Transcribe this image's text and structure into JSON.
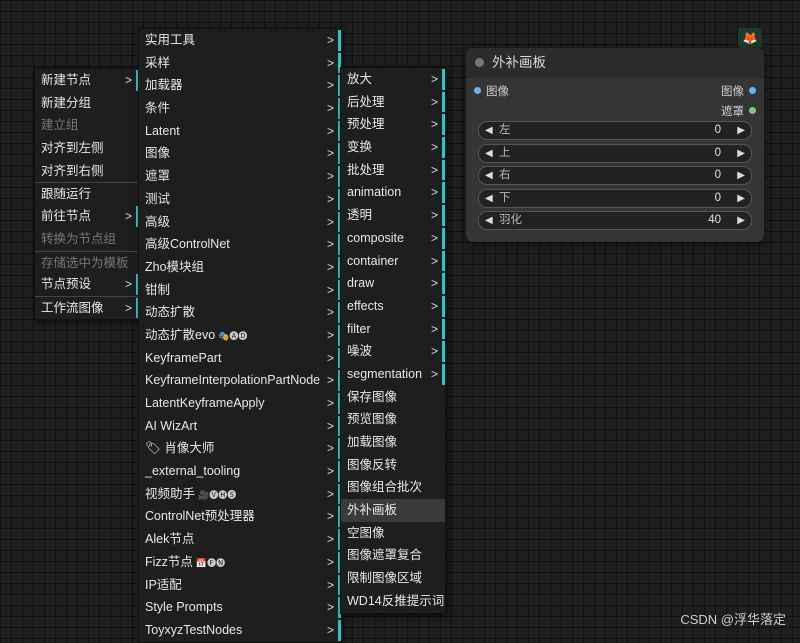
{
  "menu1": {
    "items": [
      {
        "label": "新建节点",
        "arrow": true,
        "bar": true,
        "disabled": false,
        "sep": false,
        "name": "new-node"
      },
      {
        "label": "新建分组",
        "arrow": false,
        "bar": false,
        "disabled": false,
        "sep": false,
        "name": "new-group"
      },
      {
        "label": "建立组",
        "arrow": false,
        "bar": false,
        "disabled": true,
        "sep": false,
        "name": "create-group"
      },
      {
        "label": "对齐到左侧",
        "arrow": false,
        "bar": false,
        "disabled": false,
        "sep": false,
        "name": "align-left"
      },
      {
        "label": "对齐到右侧",
        "arrow": false,
        "bar": false,
        "disabled": false,
        "sep": false,
        "name": "align-right"
      },
      {
        "label": "跟随运行",
        "arrow": false,
        "bar": false,
        "disabled": false,
        "sep": true,
        "name": "follow-run"
      },
      {
        "label": "前往节点",
        "arrow": true,
        "bar": true,
        "disabled": false,
        "sep": false,
        "name": "goto-node"
      },
      {
        "label": "转换为节点组",
        "arrow": false,
        "bar": false,
        "disabled": true,
        "sep": false,
        "name": "convert-to-group-node"
      },
      {
        "label": "存储选中为模板",
        "arrow": false,
        "bar": false,
        "disabled": true,
        "sep": true,
        "name": "save-as-template"
      },
      {
        "label": "节点预设",
        "arrow": true,
        "bar": true,
        "disabled": false,
        "sep": false,
        "name": "node-presets"
      },
      {
        "label": "工作流图像",
        "arrow": true,
        "bar": true,
        "disabled": false,
        "sep": true,
        "name": "workflow-image"
      }
    ]
  },
  "menu2": {
    "items": [
      {
        "label": "实用工具",
        "badge": "",
        "name": "utils"
      },
      {
        "label": "采样",
        "badge": "",
        "name": "sampling"
      },
      {
        "label": "加载器",
        "badge": "",
        "name": "loaders"
      },
      {
        "label": "条件",
        "badge": "",
        "name": "conditioning"
      },
      {
        "label": "Latent",
        "badge": "",
        "name": "latent"
      },
      {
        "label": "图像",
        "badge": "",
        "name": "image"
      },
      {
        "label": "遮罩",
        "badge": "",
        "name": "mask"
      },
      {
        "label": "测试",
        "badge": "",
        "name": "test"
      },
      {
        "label": "高级",
        "badge": "",
        "name": "advanced"
      },
      {
        "label": "高级ControlNet",
        "badge": "",
        "name": "advanced-controlnet"
      },
      {
        "label": "Zho模块组",
        "badge": "",
        "name": "zho-modules"
      },
      {
        "label": "钳制",
        "badge": "",
        "name": "clamp"
      },
      {
        "label": "动态扩散",
        "badge": "",
        "name": "animatediff"
      },
      {
        "label": "动态扩散evo",
        "badge": "🎭🅐🅓",
        "name": "animatediff-evo"
      },
      {
        "label": "KeyframePart",
        "badge": "",
        "name": "keyframe-part"
      },
      {
        "label": "KeyframeInterpolationPartNode",
        "badge": "",
        "name": "keyframe-interpolation"
      },
      {
        "label": "LatentKeyframeApply",
        "badge": "",
        "name": "latent-keyframe-apply"
      },
      {
        "label": "AI WizArt",
        "badge": "",
        "name": "ai-wizart"
      },
      {
        "label": "🏷 肖像大师",
        "badge": "",
        "name": "portrait-master"
      },
      {
        "label": "_external_tooling",
        "badge": "",
        "name": "external-tooling"
      },
      {
        "label": "视频助手",
        "badge": "🎥🅥🅗🅢",
        "name": "video-helper"
      },
      {
        "label": "ControlNet预处理器",
        "badge": "",
        "name": "controlnet-preprocessors"
      },
      {
        "label": "Alek节点",
        "badge": "",
        "name": "alek-nodes"
      },
      {
        "label": "Fizz节点",
        "badge": "📅🅕🅝",
        "name": "fizz-nodes"
      },
      {
        "label": "IP适配",
        "badge": "",
        "name": "ip-adapter"
      },
      {
        "label": "Style Prompts",
        "badge": "",
        "name": "style-prompts"
      },
      {
        "label": "ToyxyzTestNodes",
        "badge": "",
        "name": "toyxyz-test-nodes"
      }
    ]
  },
  "menu3": {
    "items": [
      {
        "label": "放大",
        "arrow": true,
        "highlight": false,
        "name": "upscale"
      },
      {
        "label": "后处理",
        "arrow": true,
        "highlight": false,
        "name": "postprocess"
      },
      {
        "label": "预处理",
        "arrow": true,
        "highlight": false,
        "name": "preprocess"
      },
      {
        "label": "变换",
        "arrow": true,
        "highlight": false,
        "name": "transform"
      },
      {
        "label": "批处理",
        "arrow": true,
        "highlight": false,
        "name": "batch"
      },
      {
        "label": "animation",
        "arrow": true,
        "highlight": false,
        "name": "animation"
      },
      {
        "label": "透明",
        "arrow": true,
        "highlight": false,
        "name": "transparent"
      },
      {
        "label": "composite",
        "arrow": true,
        "highlight": false,
        "name": "composite"
      },
      {
        "label": "container",
        "arrow": true,
        "highlight": false,
        "name": "container"
      },
      {
        "label": "draw",
        "arrow": true,
        "highlight": false,
        "name": "draw"
      },
      {
        "label": "effects",
        "arrow": true,
        "highlight": false,
        "name": "effects"
      },
      {
        "label": "filter",
        "arrow": true,
        "highlight": false,
        "name": "filter"
      },
      {
        "label": "噪波",
        "arrow": true,
        "highlight": false,
        "name": "noise"
      },
      {
        "label": "segmentation",
        "arrow": true,
        "highlight": false,
        "name": "segmentation"
      },
      {
        "label": "保存图像",
        "arrow": false,
        "highlight": false,
        "name": "save-image"
      },
      {
        "label": "预览图像",
        "arrow": false,
        "highlight": false,
        "name": "preview-image"
      },
      {
        "label": "加载图像",
        "arrow": false,
        "highlight": false,
        "name": "load-image"
      },
      {
        "label": "图像反转",
        "arrow": false,
        "highlight": false,
        "name": "invert-image"
      },
      {
        "label": "图像组合批次",
        "arrow": false,
        "highlight": false,
        "name": "image-batch"
      },
      {
        "label": "外补画板",
        "arrow": false,
        "highlight": true,
        "name": "pad-image-for-outpainting"
      },
      {
        "label": "空图像",
        "arrow": false,
        "highlight": false,
        "name": "empty-image"
      },
      {
        "label": "图像遮罩复合",
        "arrow": false,
        "highlight": false,
        "name": "image-composite-masked"
      },
      {
        "label": "限制图像区域",
        "arrow": false,
        "highlight": false,
        "name": "image-crop"
      },
      {
        "label": "WD14反推提示词",
        "arrow": false,
        "highlight": false,
        "name": "wd14-tagger"
      }
    ]
  },
  "node": {
    "title": "外补画板",
    "input_label": "图像",
    "output_image": "图像",
    "output_mask": "遮罩",
    "widgets": [
      {
        "name": "左",
        "value": "0"
      },
      {
        "name": "上",
        "value": "0"
      },
      {
        "name": "右",
        "value": "0"
      },
      {
        "name": "下",
        "value": "0"
      },
      {
        "name": "羽化",
        "value": "40"
      }
    ],
    "colors": {
      "image_slot": "#64b5f6",
      "mask_slot": "#81c784"
    }
  },
  "watermark": "CSDN @浮华落定",
  "icons": {
    "fox": "fox-icon"
  }
}
